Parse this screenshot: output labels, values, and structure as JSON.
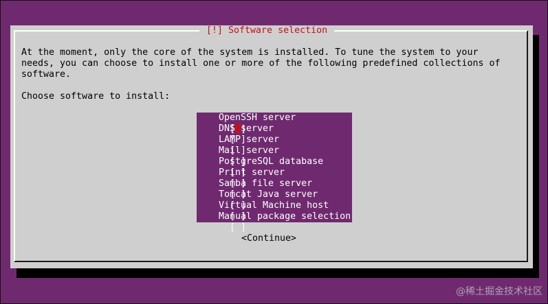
{
  "dialog": {
    "title": "[!] Software selection",
    "description_lines": [
      "At the moment, only the core of the system is installed. To tune the system to your",
      "needs, you can choose to install one or more of the following predefined collections of",
      "software."
    ],
    "prompt": "Choose software to install:"
  },
  "software_list": {
    "items": [
      {
        "checkbox": "[ ]",
        "label": "OpenSSH server",
        "checked": false,
        "focused": true
      },
      {
        "checkbox": "[ ]",
        "label": "DNS server",
        "checked": false,
        "focused": false
      },
      {
        "checkbox": "[ ]",
        "label": "LAMP server",
        "checked": false,
        "focused": false
      },
      {
        "checkbox": "[ ]",
        "label": "Mail server",
        "checked": false,
        "focused": false
      },
      {
        "checkbox": "[ ]",
        "label": "PostgreSQL database",
        "checked": false,
        "focused": false
      },
      {
        "checkbox": "[ ]",
        "label": "Print server",
        "checked": false,
        "focused": false
      },
      {
        "checkbox": "[ ]",
        "label": "Samba file server",
        "checked": false,
        "focused": false
      },
      {
        "checkbox": "[ ]",
        "label": "Tomcat Java server",
        "checked": false,
        "focused": false
      },
      {
        "checkbox": "[ ]",
        "label": "Virtual Machine host",
        "checked": false,
        "focused": false
      },
      {
        "checkbox": "[ ]",
        "label": "Manual package selection",
        "checked": false,
        "focused": false
      }
    ]
  },
  "buttons": {
    "continue_label": "<Continue>"
  },
  "watermark": "@稀土掘金技术社区",
  "colors": {
    "background": "#6f2a6f",
    "dialog": "#cfcfcf",
    "title": "#c0121e",
    "list_background": "#6f2a6f",
    "list_text": "#ffffff",
    "cursor": "#c0121e"
  }
}
